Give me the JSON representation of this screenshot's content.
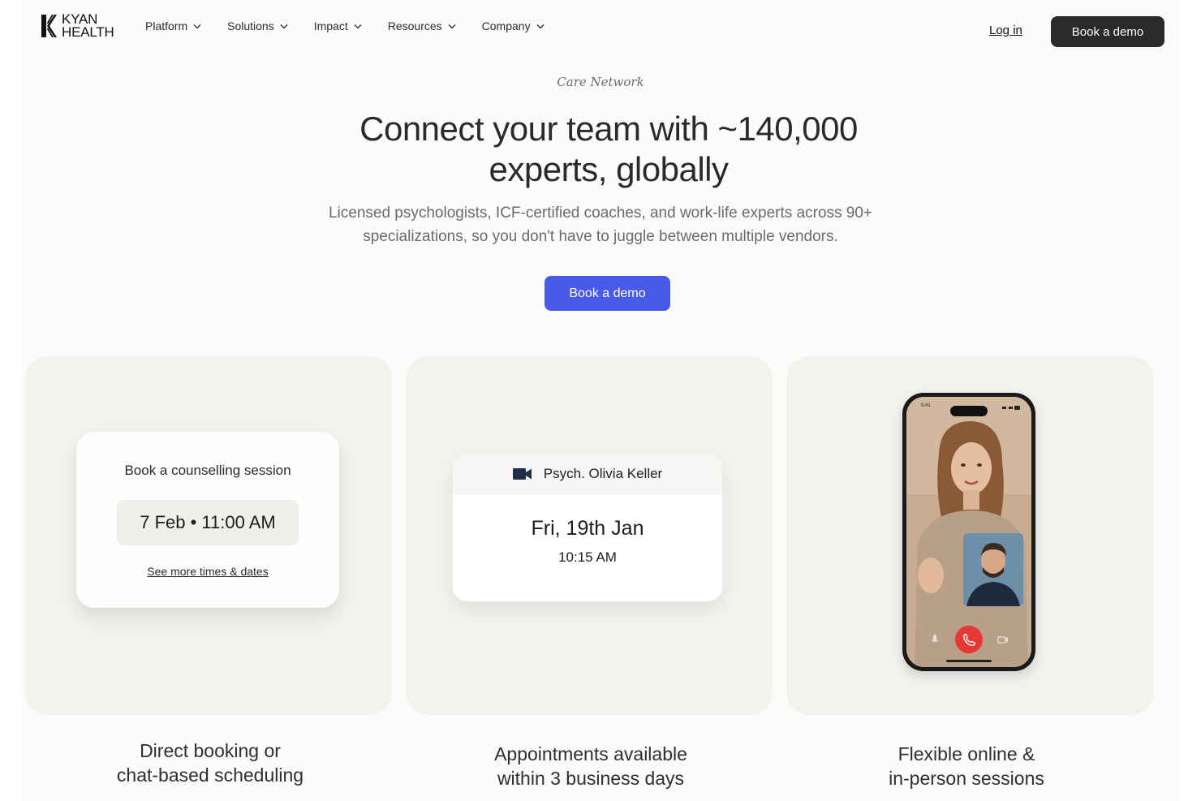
{
  "brand": {
    "line1": "KYAN",
    "line2": "HEALTH"
  },
  "nav": {
    "items": [
      {
        "label": "Platform"
      },
      {
        "label": "Solutions"
      },
      {
        "label": "Impact"
      },
      {
        "label": "Resources"
      },
      {
        "label": "Company"
      }
    ],
    "login_label": "Log in",
    "demo_label": "Book a demo"
  },
  "hero": {
    "eyebrow": "Care Network",
    "headline_line1": "Connect your team with ~140,000",
    "headline_line2": "experts, globally",
    "sub_line1": "Licensed psychologists, ICF-certified coaches, and work-life experts across 90+",
    "sub_line2": "specializations, so you don't have to juggle between multiple vendors.",
    "cta_label": "Book a demo"
  },
  "cards": {
    "booking": {
      "title": "Book a counselling session",
      "slot": "7 Feb • 11:00 AM",
      "more_link": "See more times & dates",
      "caption_line1": "Direct booking or",
      "caption_line2": "chat-based scheduling"
    },
    "appointment": {
      "expert": "Psych. Olivia Keller",
      "date": "Fri, 19th Jan",
      "time": "10:15 AM",
      "caption_line1": "Appointments available",
      "caption_line2": "within 3 business days"
    },
    "video": {
      "status_time": "9:41",
      "caption_line1": "Flexible online &",
      "caption_line2": "in-person sessions"
    }
  },
  "colors": {
    "primary": "#4a5ae8",
    "dark_button": "#2a2a2a",
    "hangup": "#e53935"
  }
}
